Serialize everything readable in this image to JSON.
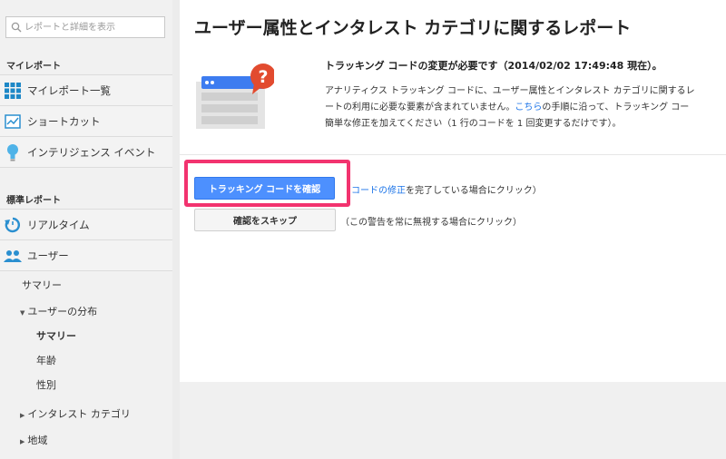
{
  "sidebar": {
    "search_placeholder": "レポートと詳細を表示",
    "my_reports_label": "マイレポート",
    "my_items": [
      {
        "label": "マイレポート一覧",
        "icon": "dashboard-grid-icon"
      },
      {
        "label": "ショートカット",
        "icon": "shortcut-icon"
      },
      {
        "label": "インテリジェンス イベント",
        "icon": "lightbulb-icon"
      }
    ],
    "standard_reports_label": "標準レポート",
    "standard_items": [
      {
        "label": "リアルタイム",
        "icon": "realtime-clock-icon"
      },
      {
        "label": "ユーザー",
        "icon": "users-icon"
      }
    ],
    "users_sub": {
      "summary": "サマリー",
      "distribution": "ユーザーの分布",
      "dist_summary": "サマリー",
      "age": "年齢",
      "gender": "性別",
      "interest": "インタレスト カテゴリ",
      "region": "地域"
    }
  },
  "main": {
    "title": "ユーザー属性とインタレスト カテゴリに関するレポート",
    "notice_heading": "トラッキング コードの変更が必要です（2014/02/02 17:49:48 現在）。",
    "notice_line1": "アナリティクス トラッキング コードに、ユーザー属性とインタレスト カテゴリに関するレ",
    "notice_line2_pre": "ートの利用に必要な要素が含まれていません。",
    "notice_link": "こちら",
    "notice_line2_post": "の手順に沿って、トラッキング コー",
    "notice_line3": "簡単な修正を加えてください（1 行のコードを 1 回変更するだけです）。",
    "verify_button": "トラッキング コードを確認",
    "verify_hint_link": "コードの修正",
    "verify_hint_rest": "を完了している場合にクリック）",
    "skip_button": "確認をスキップ",
    "skip_hint": "（この警告を常に無視する場合にクリック）"
  },
  "colors": {
    "primary_button": "#4d90fe",
    "highlight_border": "#f2336f",
    "link": "#1a73e8",
    "badge_red": "#e24b2f"
  }
}
